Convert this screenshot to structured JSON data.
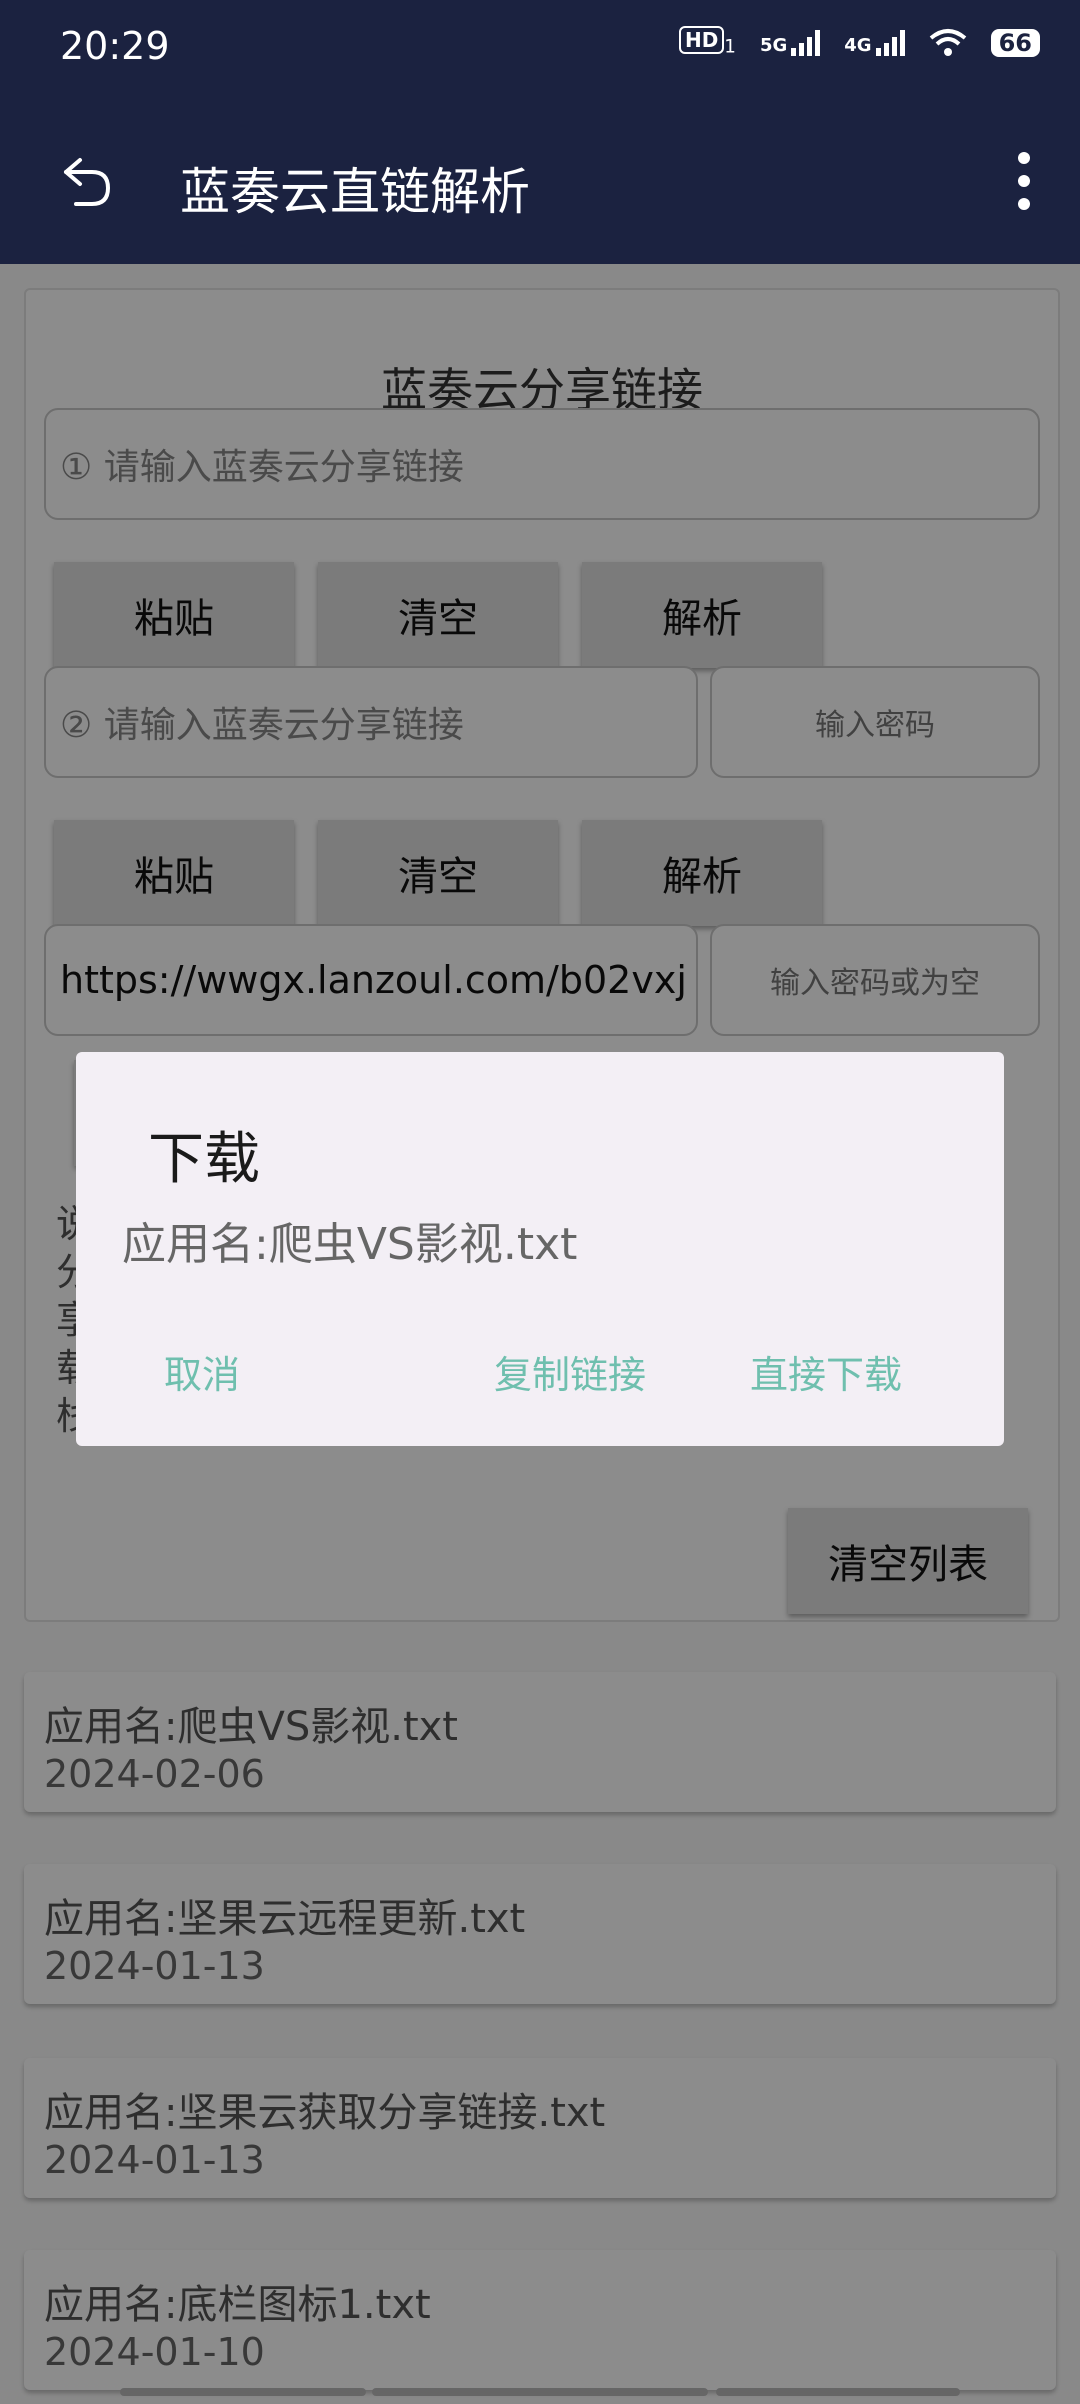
{
  "status_bar": {
    "time": "20:29",
    "hd_label": "HD",
    "hd_sub": "1",
    "sim1_label": "5G",
    "sim2_label": "4G",
    "battery": "66"
  },
  "app_bar": {
    "title": "蓝奏云直链解析",
    "back_icon": "undo-arrow-icon",
    "menu_icon": "more-vert-icon"
  },
  "card": {
    "title": "蓝奏云分享链接",
    "input1": {
      "placeholder": "① 请输入蓝奏云分享链接"
    },
    "row1_buttons": [
      "粘贴",
      "清空",
      "解析"
    ],
    "input2": {
      "placeholder": "② 请输入蓝奏云分享链接",
      "password_placeholder": "输入密码"
    },
    "row2_buttons": [
      "粘贴",
      "清空",
      "解析"
    ],
    "input3": {
      "value": "https://wwgx.lanzoul.com/b02vxj",
      "password_placeholder": "输入密码或为空"
    },
    "hint_text": "说分享载栈",
    "clear_list_label": "清空列表"
  },
  "list": [
    {
      "name": "应用名:爬虫VS影视.txt",
      "date": "2024-02-06"
    },
    {
      "name": "应用名:坚果云远程更新.txt",
      "date": "2024-01-13"
    },
    {
      "name": "应用名:坚果云获取分享链接.txt",
      "date": "2024-01-13"
    },
    {
      "name": "应用名:底栏图标1.txt",
      "date": "2024-01-10"
    }
  ],
  "dialog": {
    "title": "下载",
    "message": "应用名:爬虫VS影视.txt",
    "cancel": "取消",
    "copy_link": "复制链接",
    "direct_download": "直接下载",
    "accent_color": "#6fbfae"
  }
}
